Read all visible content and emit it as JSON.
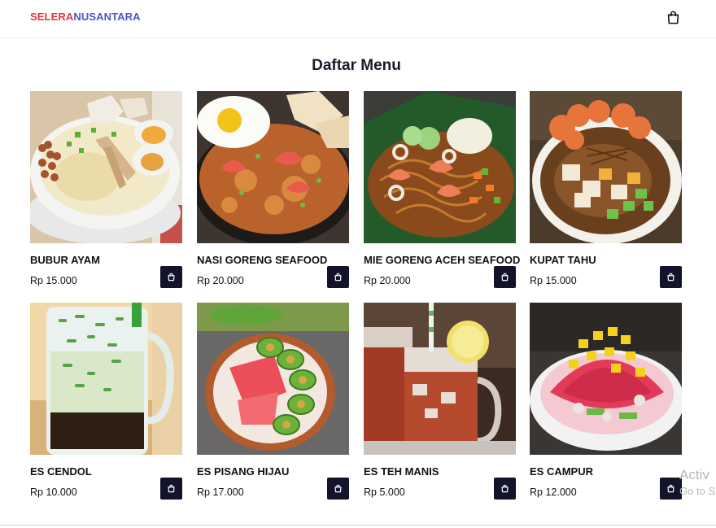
{
  "brand": {
    "part1": "SELERA",
    "part2": "NUSANTARA"
  },
  "header": {
    "cart_icon": "shopping-bag-icon"
  },
  "page_title": "Daftar Menu",
  "menu": [
    {
      "name": "BUBUR AYAM",
      "price": "Rp 15.000",
      "icon": "shopping-bag-icon"
    },
    {
      "name": "NASI GORENG SEAFOOD",
      "price": "Rp 20.000",
      "icon": "shopping-bag-icon"
    },
    {
      "name": "MIE GORENG ACEH SEAFOOD",
      "price": "Rp 20.000",
      "icon": "shopping-bag-icon"
    },
    {
      "name": "KUPAT TAHU",
      "price": "Rp 15.000",
      "icon": "shopping-bag-icon"
    },
    {
      "name": "ES CENDOL",
      "price": "Rp 10.000",
      "icon": "shopping-bag-icon"
    },
    {
      "name": "ES PISANG HIJAU",
      "price": "Rp 17.000",
      "icon": "shopping-bag-icon"
    },
    {
      "name": "ES TEH MANIS",
      "price": "Rp 5.000",
      "icon": "shopping-bag-icon"
    },
    {
      "name": "ES CAMPUR",
      "price": "Rp 12.000",
      "icon": "shopping-bag-icon"
    }
  ],
  "overlay": {
    "line1": "Activ",
    "line2": "Go to S"
  },
  "colors": {
    "brand_red": "#e3343d",
    "brand_blue": "#4b55c9",
    "button_dark": "#13132b"
  }
}
